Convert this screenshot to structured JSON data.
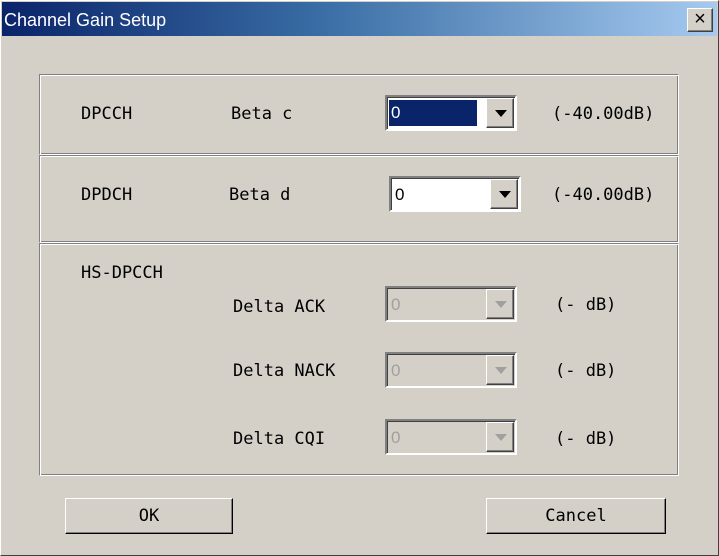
{
  "window": {
    "title": "Channel Gain Setup",
    "close_glyph": "✕"
  },
  "dpcch": {
    "name": "DPCCH",
    "param": "Beta c",
    "value": "0",
    "db": "(-40.00dB)"
  },
  "dpdch": {
    "name": "DPDCH",
    "param": "Beta d",
    "value": "0",
    "db": "(-40.00dB)"
  },
  "hs_dpcch": {
    "name": "HS-DPCCH",
    "rows": [
      {
        "param": "Delta ACK",
        "value": "0",
        "db": "(- dB)"
      },
      {
        "param": "Delta NACK",
        "value": "0",
        "db": "(- dB)"
      },
      {
        "param": "Delta CQI",
        "value": "0",
        "db": "(- dB)"
      }
    ]
  },
  "buttons": {
    "ok": "OK",
    "cancel": "Cancel"
  },
  "colors": {
    "title_start": "#0a246a",
    "title_end": "#a6caf0",
    "face": "#d4d0c8",
    "disabled_text": "#a0a0a0"
  }
}
